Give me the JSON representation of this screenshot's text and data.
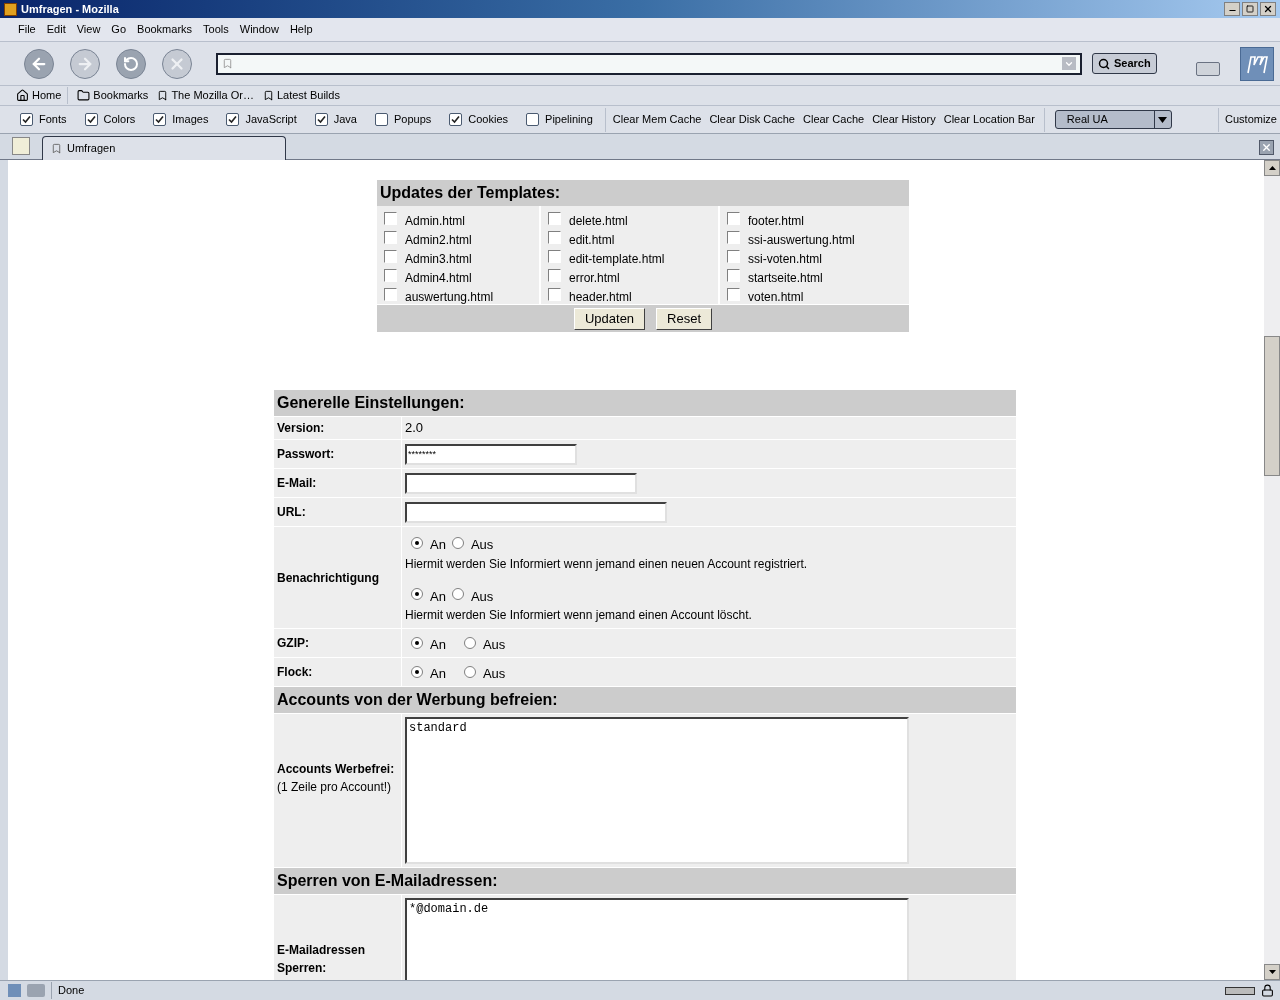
{
  "window": {
    "title": "Umfragen - Mozilla"
  },
  "menu": [
    "File",
    "Edit",
    "View",
    "Go",
    "Bookmarks",
    "Tools",
    "Window",
    "Help"
  ],
  "search_button": "Search",
  "personal_toolbar": [
    {
      "kind": "home",
      "label": "Home"
    },
    {
      "kind": "folder",
      "label": "Bookmarks"
    },
    {
      "kind": "bookmark",
      "label": "The Mozilla Or…"
    },
    {
      "kind": "bookmark",
      "label": "Latest Builds"
    }
  ],
  "prefbar": {
    "toggles": [
      {
        "label": "Fonts",
        "checked": true
      },
      {
        "label": "Colors",
        "checked": true
      },
      {
        "label": "Images",
        "checked": true
      },
      {
        "label": "JavaScript",
        "checked": true
      },
      {
        "label": "Java",
        "checked": true
      },
      {
        "label": "Popups",
        "checked": false
      },
      {
        "label": "Cookies",
        "checked": true
      },
      {
        "label": "Pipelining",
        "checked": false
      }
    ],
    "actions": [
      "Clear Mem Cache",
      "Clear Disk Cache",
      "Clear Cache",
      "Clear History",
      "Clear Location Bar"
    ],
    "ua_select": "Real UA",
    "customize": "Customize"
  },
  "tabs": [
    {
      "label": "Umfragen",
      "selected": true
    }
  ],
  "templates": {
    "title": "Updates der Templates:",
    "columns": [
      [
        {
          "label": "Admin.html",
          "checked": false
        },
        {
          "label": "Admin2.html",
          "checked": false
        },
        {
          "label": "Admin3.html",
          "checked": false
        },
        {
          "label": "Admin4.html",
          "checked": false
        },
        {
          "label": "auswertung.html",
          "checked": false
        }
      ],
      [
        {
          "label": "delete.html",
          "checked": false
        },
        {
          "label": "edit.html",
          "checked": false
        },
        {
          "label": "edit-template.html",
          "checked": false
        },
        {
          "label": "error.html",
          "checked": false
        },
        {
          "label": "header.html",
          "checked": false
        }
      ],
      [
        {
          "label": "footer.html",
          "checked": false
        },
        {
          "label": "ssi-auswertung.html",
          "checked": false
        },
        {
          "label": "ssi-voten.html",
          "checked": false
        },
        {
          "label": "startseite.html",
          "checked": false
        },
        {
          "label": "voten.html",
          "checked": false
        }
      ]
    ],
    "buttons": [
      "Updaten",
      "Reset"
    ]
  },
  "settings": [
    {
      "title": "Generelle Einstellungen:",
      "rows": [
        {
          "kind": "text",
          "label": "Version:",
          "value": "2.0"
        },
        {
          "kind": "input",
          "label": "Passwort:",
          "value": "********"
        },
        {
          "kind": "input",
          "label": "E-Mail:"
        },
        {
          "kind": "input",
          "label": "URL:"
        },
        {
          "kind": "radios",
          "label": "Benachrichtigung",
          "groups": [
            {
              "options": [
                {
                  "label": "An",
                  "selected": true
                },
                {
                  "label": "Aus",
                  "selected": false
                }
              ],
              "note": "Hiermit werden Sie Informiert wenn jemand einen neuen Account registriert."
            },
            {
              "options": [
                {
                  "label": "An",
                  "selected": true
                },
                {
                  "label": "Aus",
                  "selected": false
                }
              ],
              "note": "Hiermit werden Sie Informiert wenn jemand einen Account löscht."
            }
          ]
        },
        {
          "kind": "radios",
          "label": "GZIP:",
          "groups": [
            {
              "options": [
                {
                  "label": "An",
                  "selected": true
                },
                {
                  "label": "Aus",
                  "selected": false
                }
              ]
            }
          ]
        },
        {
          "kind": "radios",
          "label": "Flock:",
          "groups": [
            {
              "options": [
                {
                  "label": "An",
                  "selected": true
                },
                {
                  "label": "Aus",
                  "selected": false
                }
              ]
            }
          ]
        }
      ]
    },
    {
      "title": "Accounts von der Werbung befreien:",
      "rows": [
        {
          "kind": "textarea",
          "label": "Accounts Werbefrei:",
          "note": "(1 Zeile pro Account!)",
          "value": "standard"
        }
      ]
    },
    {
      "title": "Sperren von E-Mailadressen:",
      "rows": [
        {
          "kind": "textarea",
          "label": "E-Mailadressen Sperren:",
          "value": "*@domain.de"
        }
      ]
    }
  ],
  "status_bar": {
    "text": "Done"
  }
}
